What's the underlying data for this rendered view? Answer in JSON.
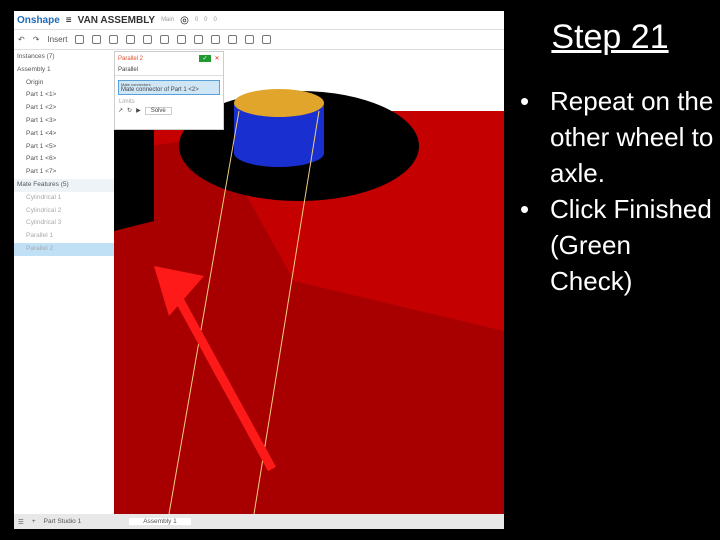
{
  "app": {
    "logo": "Onshape",
    "doc_title": "VAN ASSEMBLY",
    "branch": "Main",
    "likes": "0",
    "links": "0",
    "copies": "0"
  },
  "toolbar": {
    "insert": "Insert"
  },
  "sidebar": {
    "instances_header": "Instances (7)",
    "assembly": "Assembly 1",
    "origin": "Origin",
    "parts": [
      "Part 1 <1>",
      "Part 1 <2>",
      "Part 1 <3>",
      "Part 1 <4>",
      "Part 1 <5>",
      "Part 1 <6>",
      "Part 1 <7>"
    ],
    "mate_header": "Mate Features (5)",
    "mates": [
      "Cylindrical 1",
      "Cylindrical 2",
      "Cylindrical 3",
      "Parallel 1",
      "Parallel 2"
    ]
  },
  "panel": {
    "title": "Parallel 2",
    "type": "Parallel",
    "connector_label": "Mate connectors",
    "connector_value": "Mate connector of Part 1 <2>",
    "limits": "Limits",
    "solve": "Solve"
  },
  "bottom": {
    "tabs": [
      "Part Studio 1",
      "Assembly 1"
    ]
  },
  "slide": {
    "title": "Step 21",
    "bullets": [
      "Repeat on the other wheel to axle.",
      "Click Finished (Green Check)"
    ]
  }
}
